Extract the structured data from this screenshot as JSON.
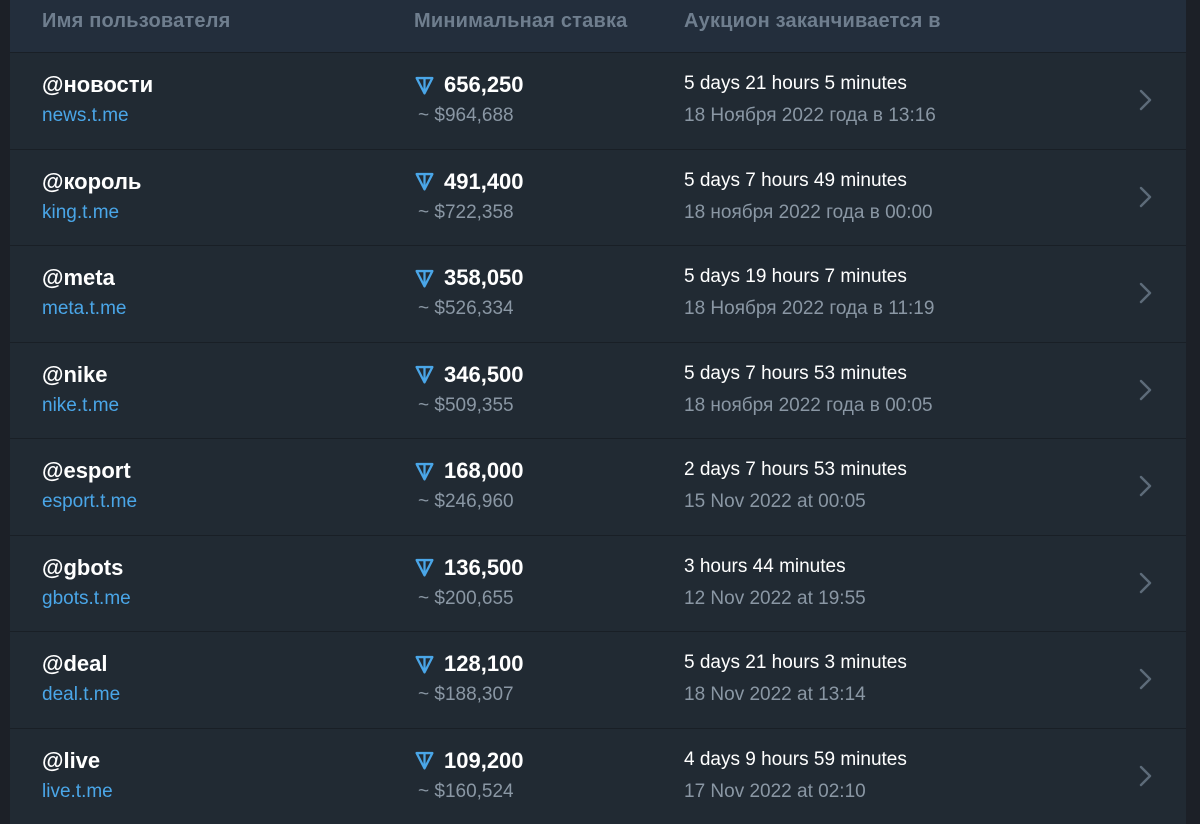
{
  "header": {
    "username": "Имя пользователя",
    "min_bid": "Минимальная ставка",
    "ends_at": "Аукцион заканчивается в"
  },
  "colors": {
    "background": "#212a33",
    "header_bg": "#232e3c",
    "link": "#4aa6e8",
    "ton": "#4aa6e8",
    "muted": "#8a97a4"
  },
  "rows": [
    {
      "username": "@новости",
      "link": "news.t.me",
      "bid": "656,250",
      "usd": "~ $964,688",
      "remaining": "5 days 21 hours 5 minutes",
      "end": "18 Ноября 2022 года в 13:16"
    },
    {
      "username": "@король",
      "link": "king.t.me",
      "bid": "491,400",
      "usd": "~ $722,358",
      "remaining": "5 days 7 hours 49 minutes",
      "end": "18 ноября 2022 года в 00:00"
    },
    {
      "username": "@meta",
      "link": "meta.t.me",
      "bid": "358,050",
      "usd": "~ $526,334",
      "remaining": "5 days 19 hours 7 minutes",
      "end": "18 Ноября 2022 года в 11:19"
    },
    {
      "username": "@nike",
      "link": "nike.t.me",
      "bid": "346,500",
      "usd": "~ $509,355",
      "remaining": "5 days 7 hours 53 minutes",
      "end": "18 ноября 2022 года в 00:05"
    },
    {
      "username": "@esport",
      "link": "esport.t.me",
      "bid": "168,000",
      "usd": "~ $246,960",
      "remaining": "2 days 7 hours 53 minutes",
      "end": "15 Nov 2022 at 00:05"
    },
    {
      "username": "@gbots",
      "link": "gbots.t.me",
      "bid": "136,500",
      "usd": "~ $200,655",
      "remaining": "3 hours 44 minutes",
      "end": "12 Nov 2022 at 19:55"
    },
    {
      "username": "@deal",
      "link": "deal.t.me",
      "bid": "128,100",
      "usd": "~ $188,307",
      "remaining": "5 days 21 hours 3 minutes",
      "end": "18 Nov 2022 at 13:14"
    },
    {
      "username": "@live",
      "link": "live.t.me",
      "bid": "109,200",
      "usd": "~ $160,524",
      "remaining": "4 days 9 hours 59 minutes",
      "end": "17 Nov 2022 at 02:10"
    }
  ]
}
